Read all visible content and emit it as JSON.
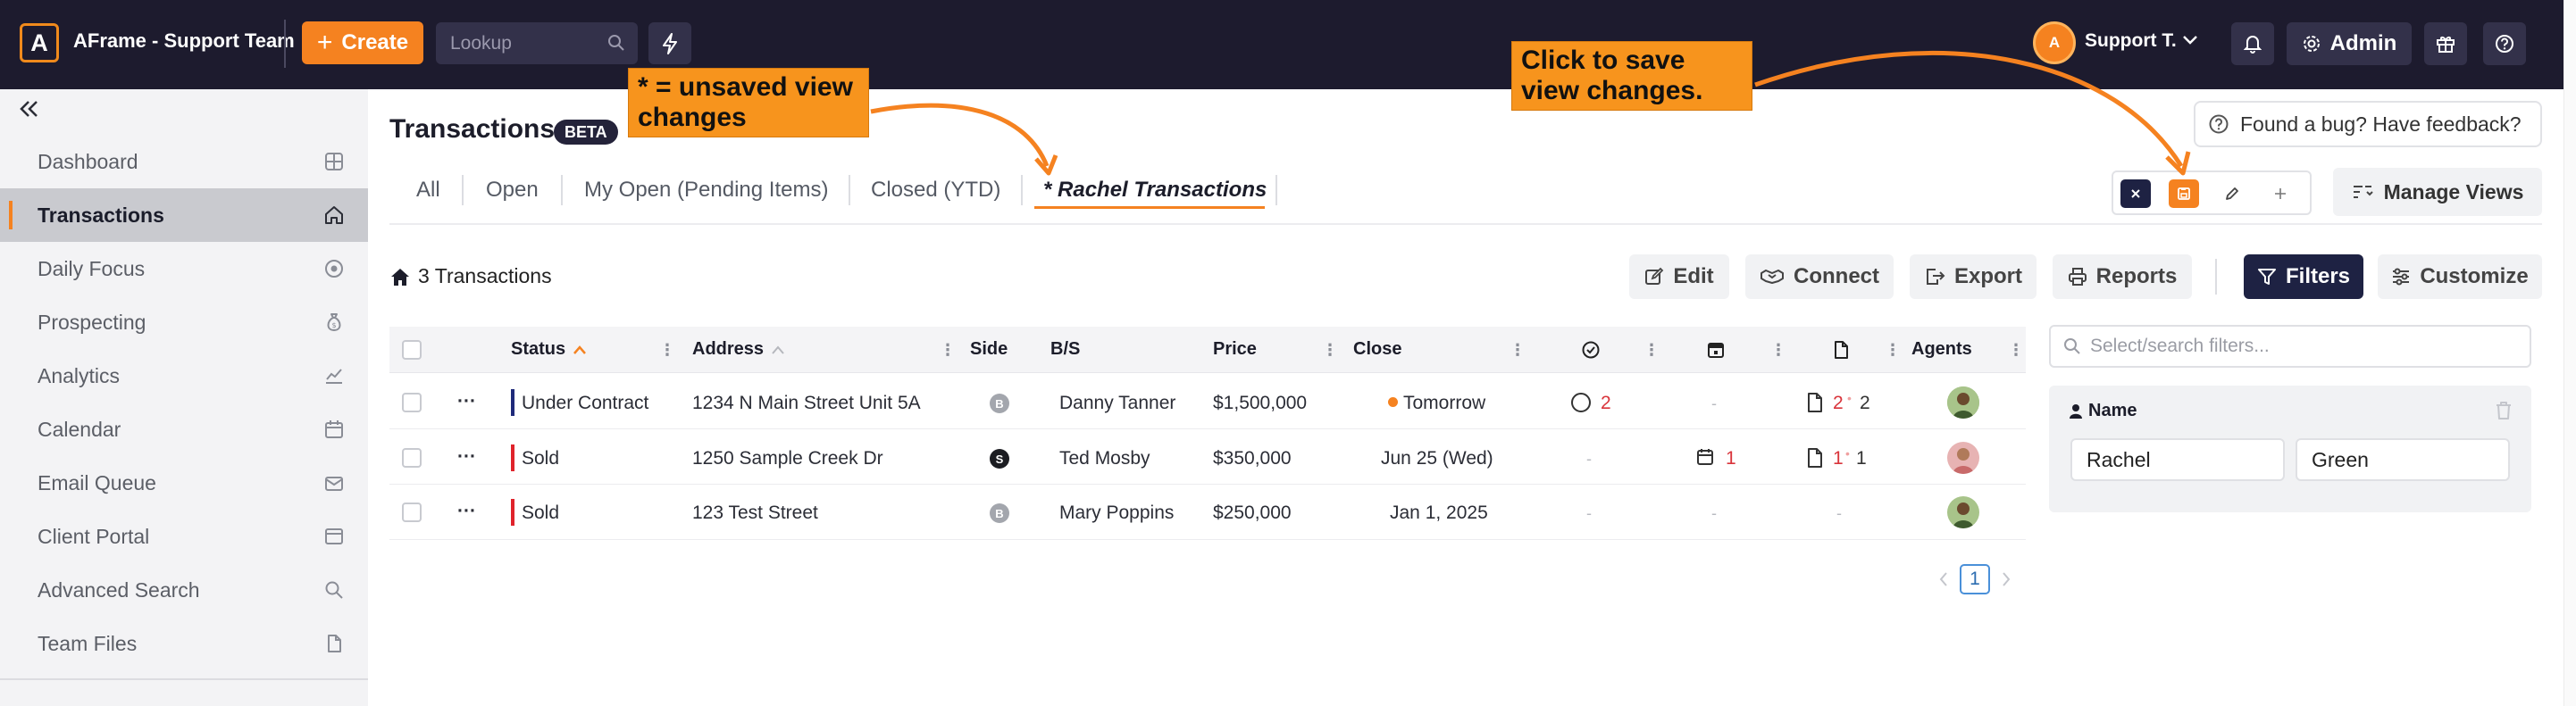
{
  "app": {
    "logo_letter": "A",
    "org_name": "AFrame - Support Team",
    "create_label": "Create",
    "lookup_placeholder": "Lookup",
    "user_avatar": "A",
    "user_name": "Support T.",
    "admin_label": "Admin"
  },
  "sidebar": {
    "items": [
      {
        "label": "Dashboard",
        "icon": "grid-icon"
      },
      {
        "label": "Transactions",
        "icon": "home-icon",
        "active": true
      },
      {
        "label": "Daily Focus",
        "icon": "target-icon"
      },
      {
        "label": "Prospecting",
        "icon": "money-bag-icon"
      },
      {
        "label": "Analytics",
        "icon": "chart-icon"
      },
      {
        "label": "Calendar",
        "icon": "calendar-icon"
      },
      {
        "label": "Email Queue",
        "icon": "mail-queue-icon"
      },
      {
        "label": "Client Portal",
        "icon": "browser-icon"
      },
      {
        "label": "Advanced Search",
        "icon": "search-icon"
      },
      {
        "label": "Team Files",
        "icon": "file-icon"
      }
    ]
  },
  "header": {
    "title": "Transactions",
    "beta": "BETA",
    "feedback": "Found a bug? Have feedback?"
  },
  "tabs": [
    "All",
    "Open",
    "My Open (Pending Items)",
    "Closed (YTD)",
    "* Rachel Transactions"
  ],
  "manage_views": "Manage Views",
  "toolbar": {
    "count": "3 Transactions",
    "edit": "Edit",
    "connect": "Connect",
    "export": "Export",
    "reports": "Reports",
    "filters": "Filters",
    "customize": "Customize"
  },
  "table": {
    "columns": {
      "status": "Status",
      "address": "Address",
      "side": "Side",
      "bs": "B/S",
      "price": "Price",
      "close": "Close",
      "agents": "Agents"
    },
    "rows": [
      {
        "status": "Under Contract",
        "status_color": "#1f2a7a",
        "address": "1234 N Main Street Unit 5A",
        "side": "B",
        "side_color": "#a3a6ad",
        "bs": "Danny Tanner",
        "price": "$1,500,000",
        "close": "Tomorrow",
        "close_dot": true,
        "tasks": "2",
        "calendar": "-",
        "docs_a": "2",
        "docs_b": "2"
      },
      {
        "status": "Sold",
        "status_color": "#e0232b",
        "address": "1250 Sample Creek Dr",
        "side": "S",
        "side_color": "#1c1d22",
        "bs": "Ted Mosby",
        "price": "$350,000",
        "close": "Jun 25 (Wed)",
        "close_dot": false,
        "tasks": "-",
        "calendar": "1",
        "docs_a": "1",
        "docs_b": "1"
      },
      {
        "status": "Sold",
        "status_color": "#e0232b",
        "address": "123 Test Street",
        "side": "B",
        "side_color": "#a3a6ad",
        "bs": "Mary Poppins",
        "price": "$250,000",
        "close": "Jan 1, 2025",
        "close_dot": false,
        "tasks": "-",
        "calendar": "-",
        "docs_a": "-",
        "docs_b": ""
      }
    ]
  },
  "pagination": {
    "current": "1"
  },
  "filters_panel": {
    "search_placeholder": "Select/search filters...",
    "name_label": "Name",
    "first_name": "Rachel",
    "last_name": "Green"
  },
  "annotations": {
    "unsaved": "* = unsaved view changes",
    "save": "Click to save view changes."
  },
  "colors": {
    "accent": "#f58220",
    "topbar": "#1d1b2e",
    "filters_btn": "#1e2243"
  }
}
